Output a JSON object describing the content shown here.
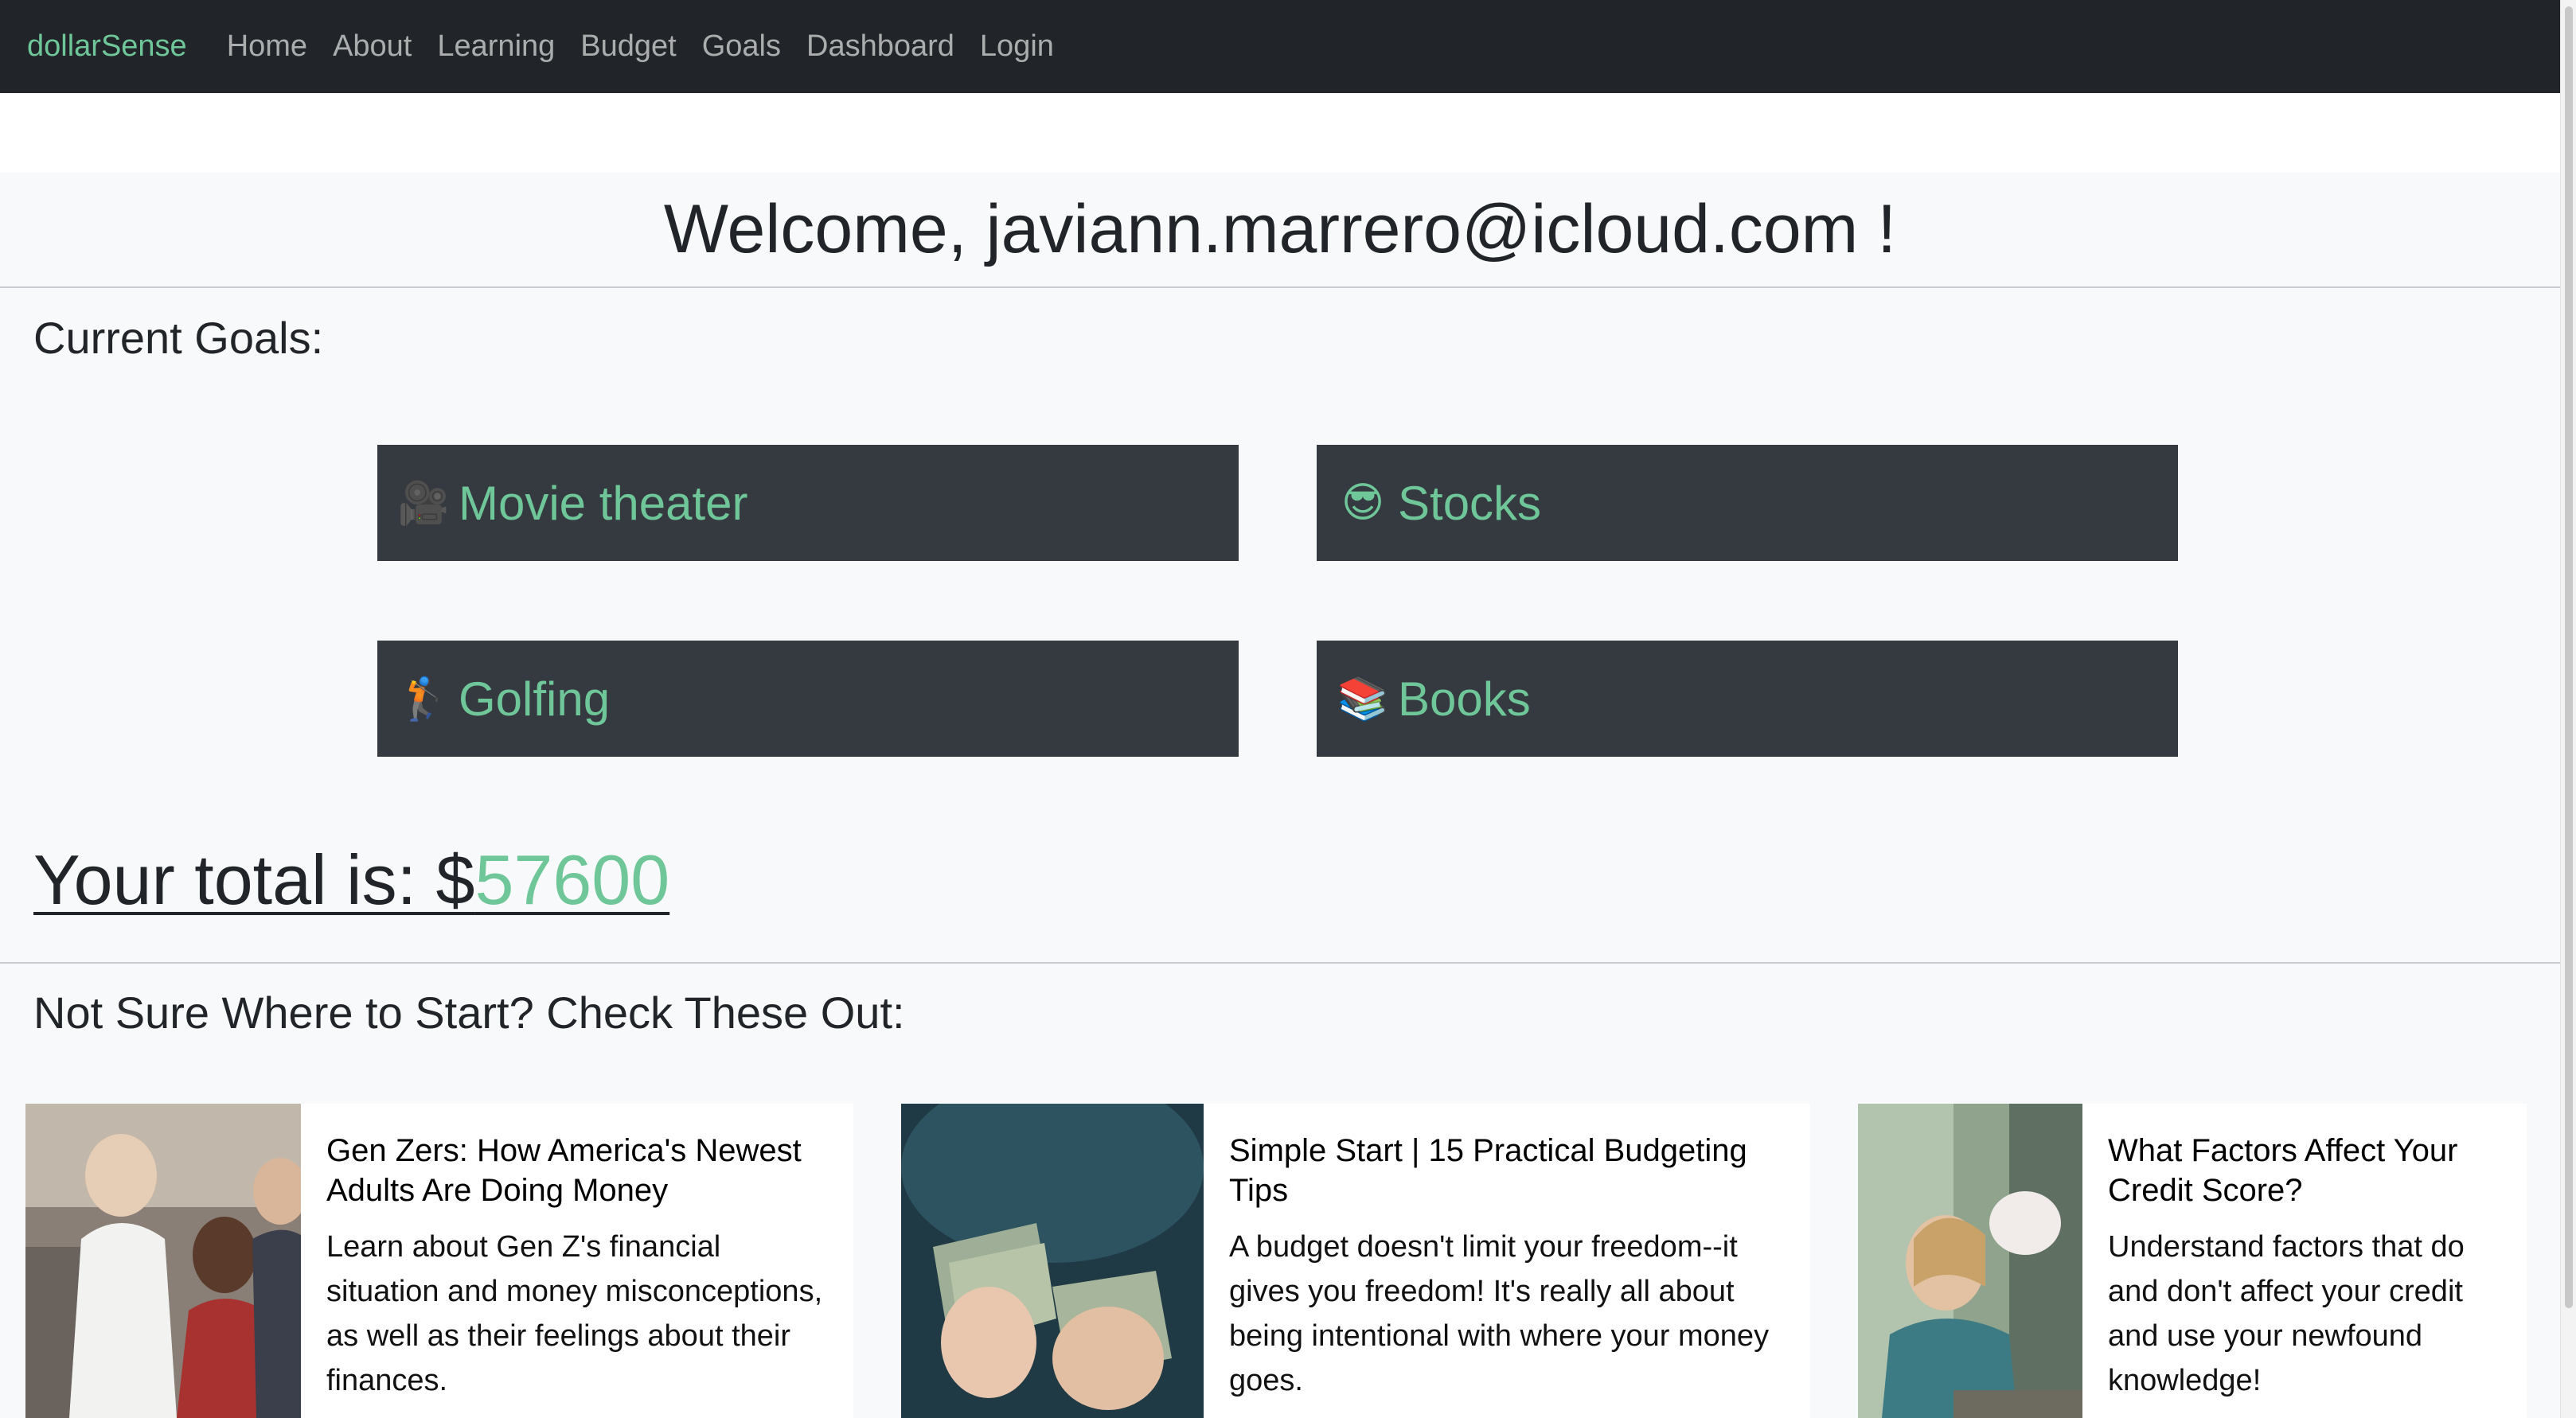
{
  "nav": {
    "brand": "dollarSense",
    "links": [
      "Home",
      "About",
      "Learning",
      "Budget",
      "Goals",
      "Dashboard",
      "Login"
    ]
  },
  "welcome": {
    "text": "Welcome, javiann.marrero@icloud.com !"
  },
  "goals_section": {
    "heading": "Current Goals:",
    "items": [
      {
        "emoji": "🎥",
        "label": "Movie theater"
      },
      {
        "emoji": "😎",
        "label": "Stocks"
      },
      {
        "emoji": "🏌",
        "label": "Golfing"
      },
      {
        "emoji": "📚",
        "label": "Books"
      }
    ]
  },
  "total": {
    "prefix": "Your total is: $",
    "amount": "57600"
  },
  "resources": {
    "heading": "Not Sure Where to Start? Check These Out:",
    "cards": [
      {
        "title": "Gen Zers: How America's Newest Adults Are Doing Money",
        "description": "Learn about Gen Z's financial situation and money misconceptions, as well as their feelings about their finances."
      },
      {
        "title": "Simple Start | 15 Practical Budgeting Tips",
        "description": "A budget doesn't limit your freedom--it gives you freedom! It's really all about being intentional with where your money goes."
      },
      {
        "title": "What Factors Affect Your Credit Score?",
        "description": "Understand factors that do and don't affect your credit and use your newfound knowledge!"
      }
    ]
  },
  "colors": {
    "navbar": "#212529",
    "accent": "#6fc698",
    "goal_tile": "#343a40",
    "page_bg": "#f8f9fa"
  }
}
